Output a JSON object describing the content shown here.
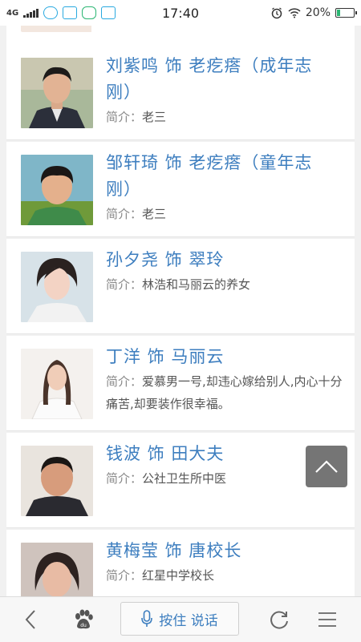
{
  "status_bar": {
    "network": "4G",
    "time": "17:40",
    "battery": "20%",
    "battery_level": 0.2
  },
  "cast": [
    {
      "name": "刘紫鸣 饰 老疙瘩（成年志刚）",
      "desc_label": "简介：",
      "desc": "老三"
    },
    {
      "name": "邹轩琦 饰 老疙瘩（童年志刚）",
      "desc_label": "简介：",
      "desc": "老三"
    },
    {
      "name": "孙夕尧 饰 翠玲",
      "desc_label": "简介：",
      "desc": "林浩和马丽云的养女"
    },
    {
      "name": "丁洋 饰 马丽云",
      "desc_label": "简介：",
      "desc": "爱慕男一号,却违心嫁给别人,内心十分痛苦,却要装作很幸福。"
    },
    {
      "name": "钱波 饰 田大夫",
      "desc_label": "简介：",
      "desc": "公社卫生所中医"
    },
    {
      "name": "黄梅莹 饰 唐校长",
      "desc_label": "简介：",
      "desc": "红星中学校长"
    }
  ],
  "bottom_bar": {
    "voice_label": "按住 说话",
    "icons": [
      "back-arrow-icon",
      "paw-icon",
      "microphone-icon",
      "refresh-icon",
      "menu-icon"
    ]
  },
  "colors": {
    "link": "#3d7ebf",
    "text": "#555555"
  }
}
